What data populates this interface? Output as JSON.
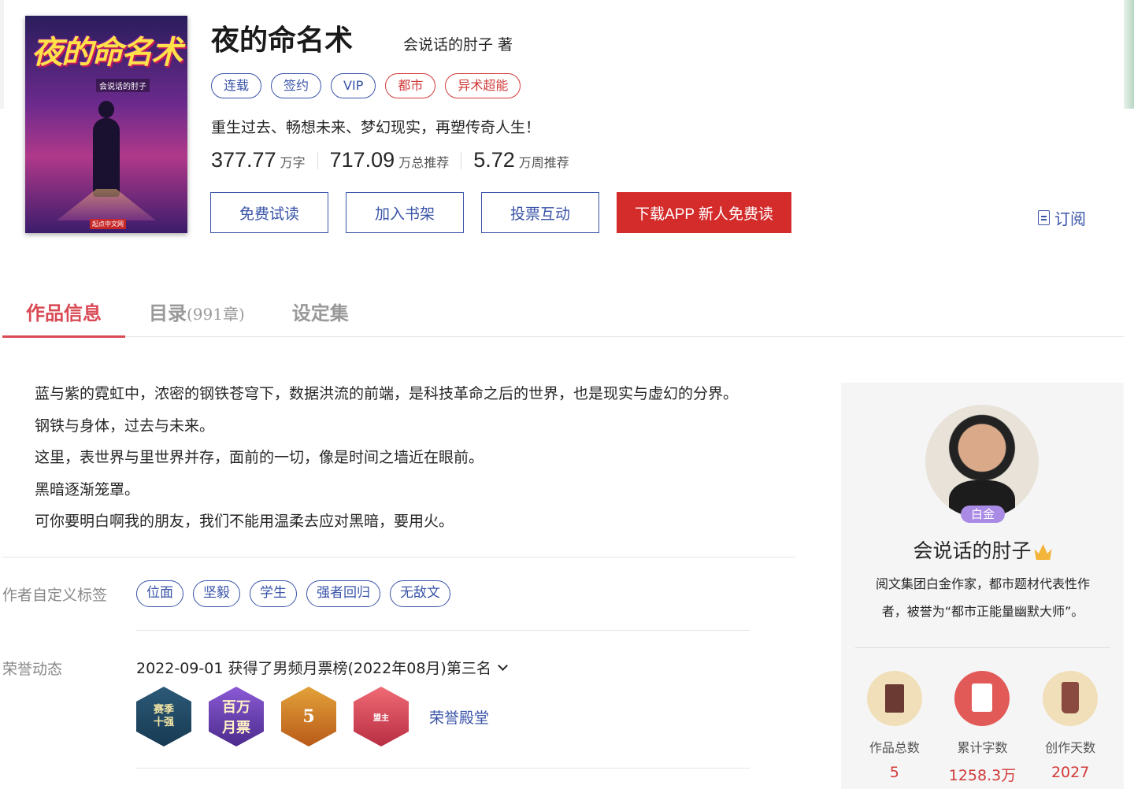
{
  "book": {
    "cover": {
      "title_art": "夜的命名术",
      "author_art": "会说话的肘子",
      "publisher_art": "起点中文网"
    },
    "title": "夜的命名术",
    "author_line": "会说话的肘子 著",
    "tags": [
      {
        "label": "连载",
        "style": "blue"
      },
      {
        "label": "签约",
        "style": "blue"
      },
      {
        "label": "VIP",
        "style": "blue"
      },
      {
        "label": "都市",
        "style": "red"
      },
      {
        "label": "异术超能",
        "style": "red"
      }
    ],
    "intro": "重生过去、畅想未来、梦幻现实，再塑传奇人生！",
    "stats": [
      {
        "value": "377.77",
        "unit": "万字"
      },
      {
        "value": "717.09",
        "unit": "万总推荐"
      },
      {
        "value": "5.72",
        "unit": "万周推荐"
      }
    ]
  },
  "actions": {
    "free_read": "免费试读",
    "add_shelf": "加入书架",
    "vote": "投票互动",
    "download_app": "下载APP 新人免费读",
    "subscribe": "订阅"
  },
  "tabs": {
    "info": "作品信息",
    "catalog": "目录",
    "catalog_count": "(991章)",
    "settings": "设定集"
  },
  "description": [
    "蓝与紫的霓虹中，浓密的钢铁苍穹下，数据洪流的前端，是科技革命之后的世界，也是现实与虚幻的分界。",
    "钢铁与身体，过去与未来。",
    "这里，表世界与里世界并存，面前的一切，像是时间之墙近在眼前。",
    "黑暗逐渐笼罩。",
    "可你要明白啊我的朋友，我们不能用温柔去应对黑暗，要用火。"
  ],
  "custom_tags": {
    "label": "作者自定义标签",
    "items": [
      "位面",
      "坚毅",
      "学生",
      "强者回归",
      "无敌文"
    ]
  },
  "honors": {
    "label": "荣誉动态",
    "latest": "2022-09-01 获得了男频月票榜(2022年08月)第三名",
    "badges": [
      {
        "text": "赛季\n十强",
        "icon": "season-top10-badge"
      },
      {
        "text": "百万\n月票",
        "icon": "million-monthly-ticket-badge"
      },
      {
        "text": "5",
        "icon": "five-star-badge"
      },
      {
        "text": "盟主",
        "icon": "leader-badge"
      }
    ],
    "hall_link": "荣誉殿堂"
  },
  "author": {
    "level": "白金",
    "name": "会说话的肘子",
    "bio": "阅文集团白金作家，都市题材代表性作者，被誉为“都市正能量幽默大师”。",
    "stats": [
      {
        "label": "作品总数",
        "value": "5"
      },
      {
        "label": "累计字数",
        "value": "1258.3万"
      },
      {
        "label": "创作天数",
        "value": "2027"
      }
    ]
  },
  "colors": {
    "accent_blue": "#3a54a8",
    "accent_red": "#d42b2b",
    "tab_active": "#d94a55"
  }
}
